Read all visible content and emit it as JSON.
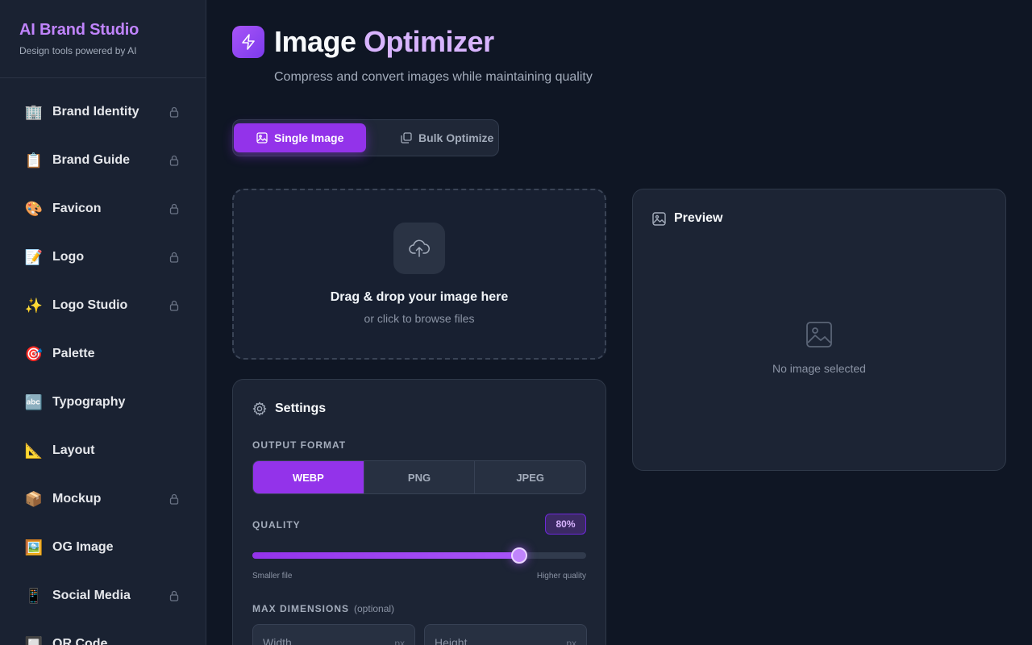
{
  "sidebar": {
    "brand_title": "AI Brand Studio",
    "brand_subtitle": "Design tools powered by AI",
    "items": [
      {
        "emoji": "🏢",
        "label": "Brand Identity",
        "locked": true
      },
      {
        "emoji": "📋",
        "label": "Brand Guide",
        "locked": true
      },
      {
        "emoji": "🎨",
        "label": "Favicon",
        "locked": true
      },
      {
        "emoji": "📝",
        "label": "Logo",
        "locked": true
      },
      {
        "emoji": "✨",
        "label": "Logo Studio",
        "locked": true
      },
      {
        "emoji": "🎯",
        "label": "Palette",
        "locked": false
      },
      {
        "emoji": "🔤",
        "label": "Typography",
        "locked": false
      },
      {
        "emoji": "📐",
        "label": "Layout",
        "locked": false
      },
      {
        "emoji": "📦",
        "label": "Mockup",
        "locked": true
      },
      {
        "emoji": "🖼️",
        "label": "OG Image",
        "locked": false
      },
      {
        "emoji": "📱",
        "label": "Social Media",
        "locked": true
      },
      {
        "emoji": "🔲",
        "label": "QR Code",
        "locked": false
      }
    ]
  },
  "header": {
    "title_main": "Image ",
    "title_accent": "Optimizer",
    "subtitle": "Compress and convert images while maintaining quality"
  },
  "tabs": {
    "single": "Single Image",
    "bulk": "Bulk Optimize"
  },
  "dropzone": {
    "title": "Drag & drop your image here",
    "subtitle": "or click to browse files"
  },
  "settings": {
    "title": "Settings",
    "output_format_label": "OUTPUT FORMAT",
    "formats": [
      "WEBP",
      "PNG",
      "JPEG"
    ],
    "selected_format": "WEBP",
    "quality_label": "QUALITY",
    "quality_value": 80,
    "quality_text": "80%",
    "hint_low": "Smaller file",
    "hint_high": "Higher quality",
    "max_dim_label": "MAX DIMENSIONS",
    "max_dim_optional": "(optional)",
    "width_placeholder": "Width",
    "height_placeholder": "Height",
    "unit": "px"
  },
  "preview": {
    "title": "Preview",
    "empty_text": "No image selected"
  },
  "colors": {
    "accent": "#9333ea",
    "accent_light": "#c084fc",
    "background": "#0f1624"
  }
}
